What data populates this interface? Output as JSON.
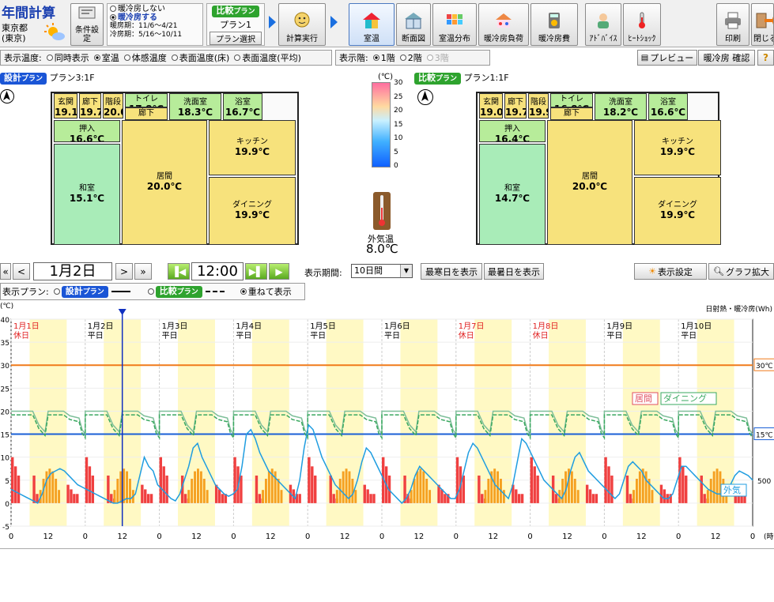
{
  "toolbar": {
    "app_title": "年間計算",
    "location_line1": "東京都",
    "location_line2": "(東京)",
    "cond_button": "条件設定",
    "cooling_opt_off": "暖冷房しない",
    "cooling_opt_on": "暖冷房する",
    "heating_period": "暖房期：11/6〜4/21",
    "cooling_period": "冷房期：5/16〜10/11",
    "compare_badge": "比較",
    "plan_badge_suffix": "プラン",
    "plan_name": "プラン1",
    "plan_select": "プラン選択",
    "calc_button": "計算実行",
    "view_buttons": [
      "室温",
      "断面図",
      "室温分布",
      "暖冷房負荷",
      "暖冷房費"
    ],
    "advice_button": "ｱﾄﾞﾊﾞｲｽ",
    "heatshock_button": "ﾋｰﾄｼｮｯｸ",
    "print_button": "印刷",
    "close_button": "閉じる"
  },
  "display_bar": {
    "temp_label": "表示温度:",
    "temp_options": [
      "同時表示",
      "室温",
      "体感温度",
      "表面温度(床)",
      "表面温度(平均)"
    ],
    "floor_label": "表示階:",
    "floor_options": [
      "1階",
      "2階",
      "3階"
    ],
    "preview_button": "プレビュー",
    "confirm_button": "暖冷房 確認",
    "help_button": "?"
  },
  "left_plan": {
    "badge": "設計",
    "name": "プラン3:1F",
    "rooms": [
      {
        "name": "玄関",
        "temp": "19.1℃"
      },
      {
        "name": "廊下",
        "temp": "19.7℃"
      },
      {
        "name": "階段",
        "temp": "20.0℃"
      },
      {
        "name": "トイレ",
        "temp": "17.8℃"
      },
      {
        "name": "廊下",
        "temp": "20.0℃"
      },
      {
        "name": "洗面室",
        "temp": "18.3℃"
      },
      {
        "name": "浴室",
        "temp": "16.7℃"
      },
      {
        "name": "押入",
        "temp": "16.6℃"
      },
      {
        "name": "和室",
        "temp": "15.1℃"
      },
      {
        "name": "居間",
        "temp": "20.0℃"
      },
      {
        "name": "キッチン",
        "temp": "19.9℃"
      },
      {
        "name": "ダイニング",
        "temp": "19.9℃"
      }
    ]
  },
  "right_plan": {
    "badge": "比較",
    "name": "プラン1:1F",
    "rooms": [
      {
        "name": "玄関",
        "temp": "19.0℃"
      },
      {
        "name": "廊下",
        "temp": "19.7℃"
      },
      {
        "name": "階段",
        "temp": "19.9℃"
      },
      {
        "name": "トイレ",
        "temp": "16.8℃"
      },
      {
        "name": "廊下",
        "temp": "19.9℃"
      },
      {
        "name": "洗面室",
        "temp": "18.2℃"
      },
      {
        "name": "浴室",
        "temp": "16.6℃"
      },
      {
        "name": "押入",
        "temp": "16.4℃"
      },
      {
        "name": "和室",
        "temp": "14.7℃"
      },
      {
        "name": "居間",
        "temp": "20.0℃"
      },
      {
        "name": "キッチン",
        "temp": "19.9℃"
      },
      {
        "name": "ダイニング",
        "temp": "19.9℃"
      }
    ]
  },
  "color_scale": {
    "unit": "(℃)",
    "ticks": [
      "30",
      "25",
      "20",
      "15",
      "10",
      "5",
      "0"
    ],
    "outside_label": "外気温",
    "outside_value": "8.0℃"
  },
  "nav": {
    "first": "«",
    "prev": "<",
    "date": "1月2日",
    "next": ">",
    "last": "»",
    "time": "12:00",
    "period_label": "表示期間:",
    "period_value": "10日間",
    "coldest_button": "最寒日を表示",
    "hottest_button": "最暑日を表示",
    "display_settings": "表示設定",
    "graph_zoom": "グラフ拡大"
  },
  "plan_legend": {
    "label": "表示プラン:",
    "design": "設計",
    "compare": "比較",
    "plan_suffix": "プラン",
    "overlay": "重ねて表示"
  },
  "chart_data": {
    "type": "line",
    "ylabel": "(℃)",
    "right_label": "日射熱・暖冷房(Wh)",
    "ylim": [
      -5,
      40
    ],
    "yticks": [
      -5,
      0,
      5,
      10,
      15,
      20,
      25,
      30,
      35,
      40
    ],
    "xlabel": "(時)",
    "xticks": [
      "0",
      "12",
      "0",
      "12",
      "0",
      "12",
      "0",
      "12",
      "0",
      "12",
      "0",
      "12",
      "0",
      "12",
      "0",
      "12",
      "0",
      "12",
      "0",
      "12",
      "0"
    ],
    "days": [
      {
        "date": "1月1日",
        "kind": "休日",
        "holiday": true
      },
      {
        "date": "1月2日",
        "kind": "平日",
        "holiday": false
      },
      {
        "date": "1月3日",
        "kind": "平日",
        "holiday": false
      },
      {
        "date": "1月4日",
        "kind": "平日",
        "holiday": false
      },
      {
        "date": "1月5日",
        "kind": "平日",
        "holiday": false
      },
      {
        "date": "1月6日",
        "kind": "平日",
        "holiday": false
      },
      {
        "date": "1月7日",
        "kind": "休日",
        "holiday": true
      },
      {
        "date": "1月8日",
        "kind": "休日",
        "holiday": true
      },
      {
        "date": "1月9日",
        "kind": "平日",
        "holiday": false
      },
      {
        "date": "1月10日",
        "kind": "平日",
        "holiday": false
      }
    ],
    "ref_lines": [
      {
        "value": 30,
        "label": "30℃",
        "color": "#f07a1a"
      },
      {
        "value": 15,
        "label": "15℃",
        "color": "#1a5fd6"
      }
    ],
    "right_tick": "500",
    "current_hour": 36,
    "series": [
      {
        "name": "居間",
        "color": "#7fbf9a",
        "room_level": 20
      },
      {
        "name": "ダイニング",
        "color": "#3aa860",
        "room_level": 19.6
      },
      {
        "name": "外気",
        "color": "#1f9de0",
        "values": [
          3,
          2.5,
          2,
          1.5,
          1,
          0.5,
          0,
          2,
          5,
          6.5,
          7,
          7.5,
          7,
          6,
          5,
          4,
          3.5,
          3,
          2.5,
          2,
          1.5,
          1,
          0.5,
          0,
          0,
          0.5,
          1,
          1,
          2,
          6,
          10,
          8,
          7,
          4,
          3,
          2,
          1,
          0.5,
          2,
          5,
          8,
          12,
          13,
          10,
          8,
          6,
          4,
          3,
          2,
          1.5,
          2,
          3,
          8,
          15,
          16,
          14,
          11,
          9,
          7,
          6,
          5,
          4,
          3,
          2,
          1,
          5,
          12,
          17,
          16,
          13,
          10,
          8,
          6,
          4,
          3,
          2,
          1,
          2,
          5,
          9,
          12,
          11,
          9,
          7,
          5,
          3,
          2,
          1,
          0,
          1,
          3,
          6,
          8,
          7,
          6,
          5,
          4,
          3,
          2,
          1,
          1,
          3,
          7,
          11,
          13,
          12,
          10,
          8,
          6,
          4,
          3,
          2,
          1,
          4,
          9,
          14,
          13,
          11,
          9,
          7,
          5,
          4,
          3,
          2,
          1,
          3,
          7,
          10,
          11,
          9,
          7,
          6,
          5,
          4,
          3,
          2,
          1,
          2,
          5,
          8,
          9,
          8,
          7,
          5,
          4,
          3,
          2,
          1,
          1,
          2,
          5,
          8,
          8,
          7,
          6,
          5,
          4,
          3,
          2.5,
          2,
          2,
          2,
          4,
          6,
          7,
          6.5,
          6,
          5
        ]
      }
    ],
    "labels": {
      "living": "居間",
      "dining": "ダイニング",
      "outside": "外気"
    }
  }
}
